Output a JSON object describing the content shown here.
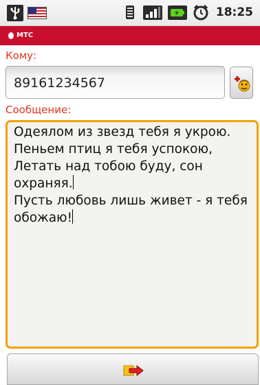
{
  "status_bar": {
    "time": "18:25",
    "icons": [
      "usb-icon",
      "flag-icon",
      "vibrate-icon",
      "signal-icon",
      "battery-icon",
      "alarm-icon"
    ]
  },
  "title_bar": {
    "brand": "МТС",
    "color": "#c8102e"
  },
  "form": {
    "to_label": "Кому:",
    "to_value": "89161234567",
    "message_label": "Сообщение:",
    "message_lines": [
      "Одеялом из звезд тебя я укрою.",
      "Пеньем птиц я тебя успокою,",
      "Летать над тобою буду, сон",
      "охраняя.",
      "Пусть любовь лишь живет - я тебя",
      "обожаю!"
    ],
    "add_contact_icon": "add-contact-icon",
    "send_icon": "send-arrow-icon"
  },
  "colors": {
    "accent_label": "#e23320",
    "focus_border": "#f4a000"
  }
}
